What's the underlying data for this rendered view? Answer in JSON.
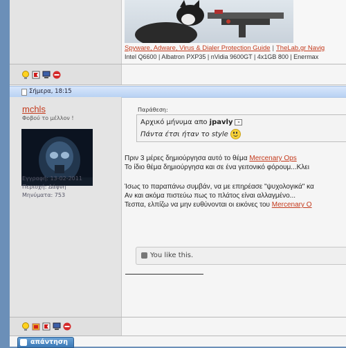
{
  "signature": {
    "links": [
      "Spyware, Adware, Virus & Dialer Protection Guide",
      "TheLab.gr Navig"
    ],
    "link_separator": "|",
    "specs": "Intel Q6600 | Albatron PXP35 | nVidia 9600GT | 4x1GB 800 | Enermax"
  },
  "top_icons": [
    "lightbulb-icon",
    "report-flag-icon",
    "computer-icon",
    "block-icon"
  ],
  "post": {
    "date": "Σήμερα, 18:15",
    "username": "mchls",
    "user_title": "Φοβού το μέλλον !",
    "registration": "Εγγραφή: 13-02-2011",
    "location": "Περιοχή: Δάφνη",
    "messages": "Μηνύματα: 753",
    "quote_label": "Παράθεση:",
    "quote_original_prefix": "Αρχικό μήνυμα απο",
    "quote_author": "jpavly",
    "quote_text": "Πάντα έτσι ήταν το style",
    "body_line1_text": "Πριν 3 μέρες δημιούργησα αυτό το θέμα ",
    "body_line1_link": "Mercenary Ops",
    "body_line2": "Το ίδιο θέμα δημιούργησα και σε ένα γειτονικό φόρουμ...Κλει",
    "body_line3": "Ίσως το παραπάνω συμβάν, να με επηρέασε \"ψυχολογικά\" κα",
    "body_line4": "Αν και ακόμα πιστεύω πως το πλάτος είναι αλλαγμένο...",
    "body_line5_text": "Τεσπα, ελπίζω να μην ευθύνονται οι εικόνες του ",
    "body_line5_link": "Mercenary O",
    "like_text": "You like this."
  },
  "bottom_icons": [
    "lightbulb-icon",
    "thanks-icon",
    "report-flag-icon",
    "computer-icon",
    "block-icon"
  ],
  "reply_button": "απάντηση"
}
